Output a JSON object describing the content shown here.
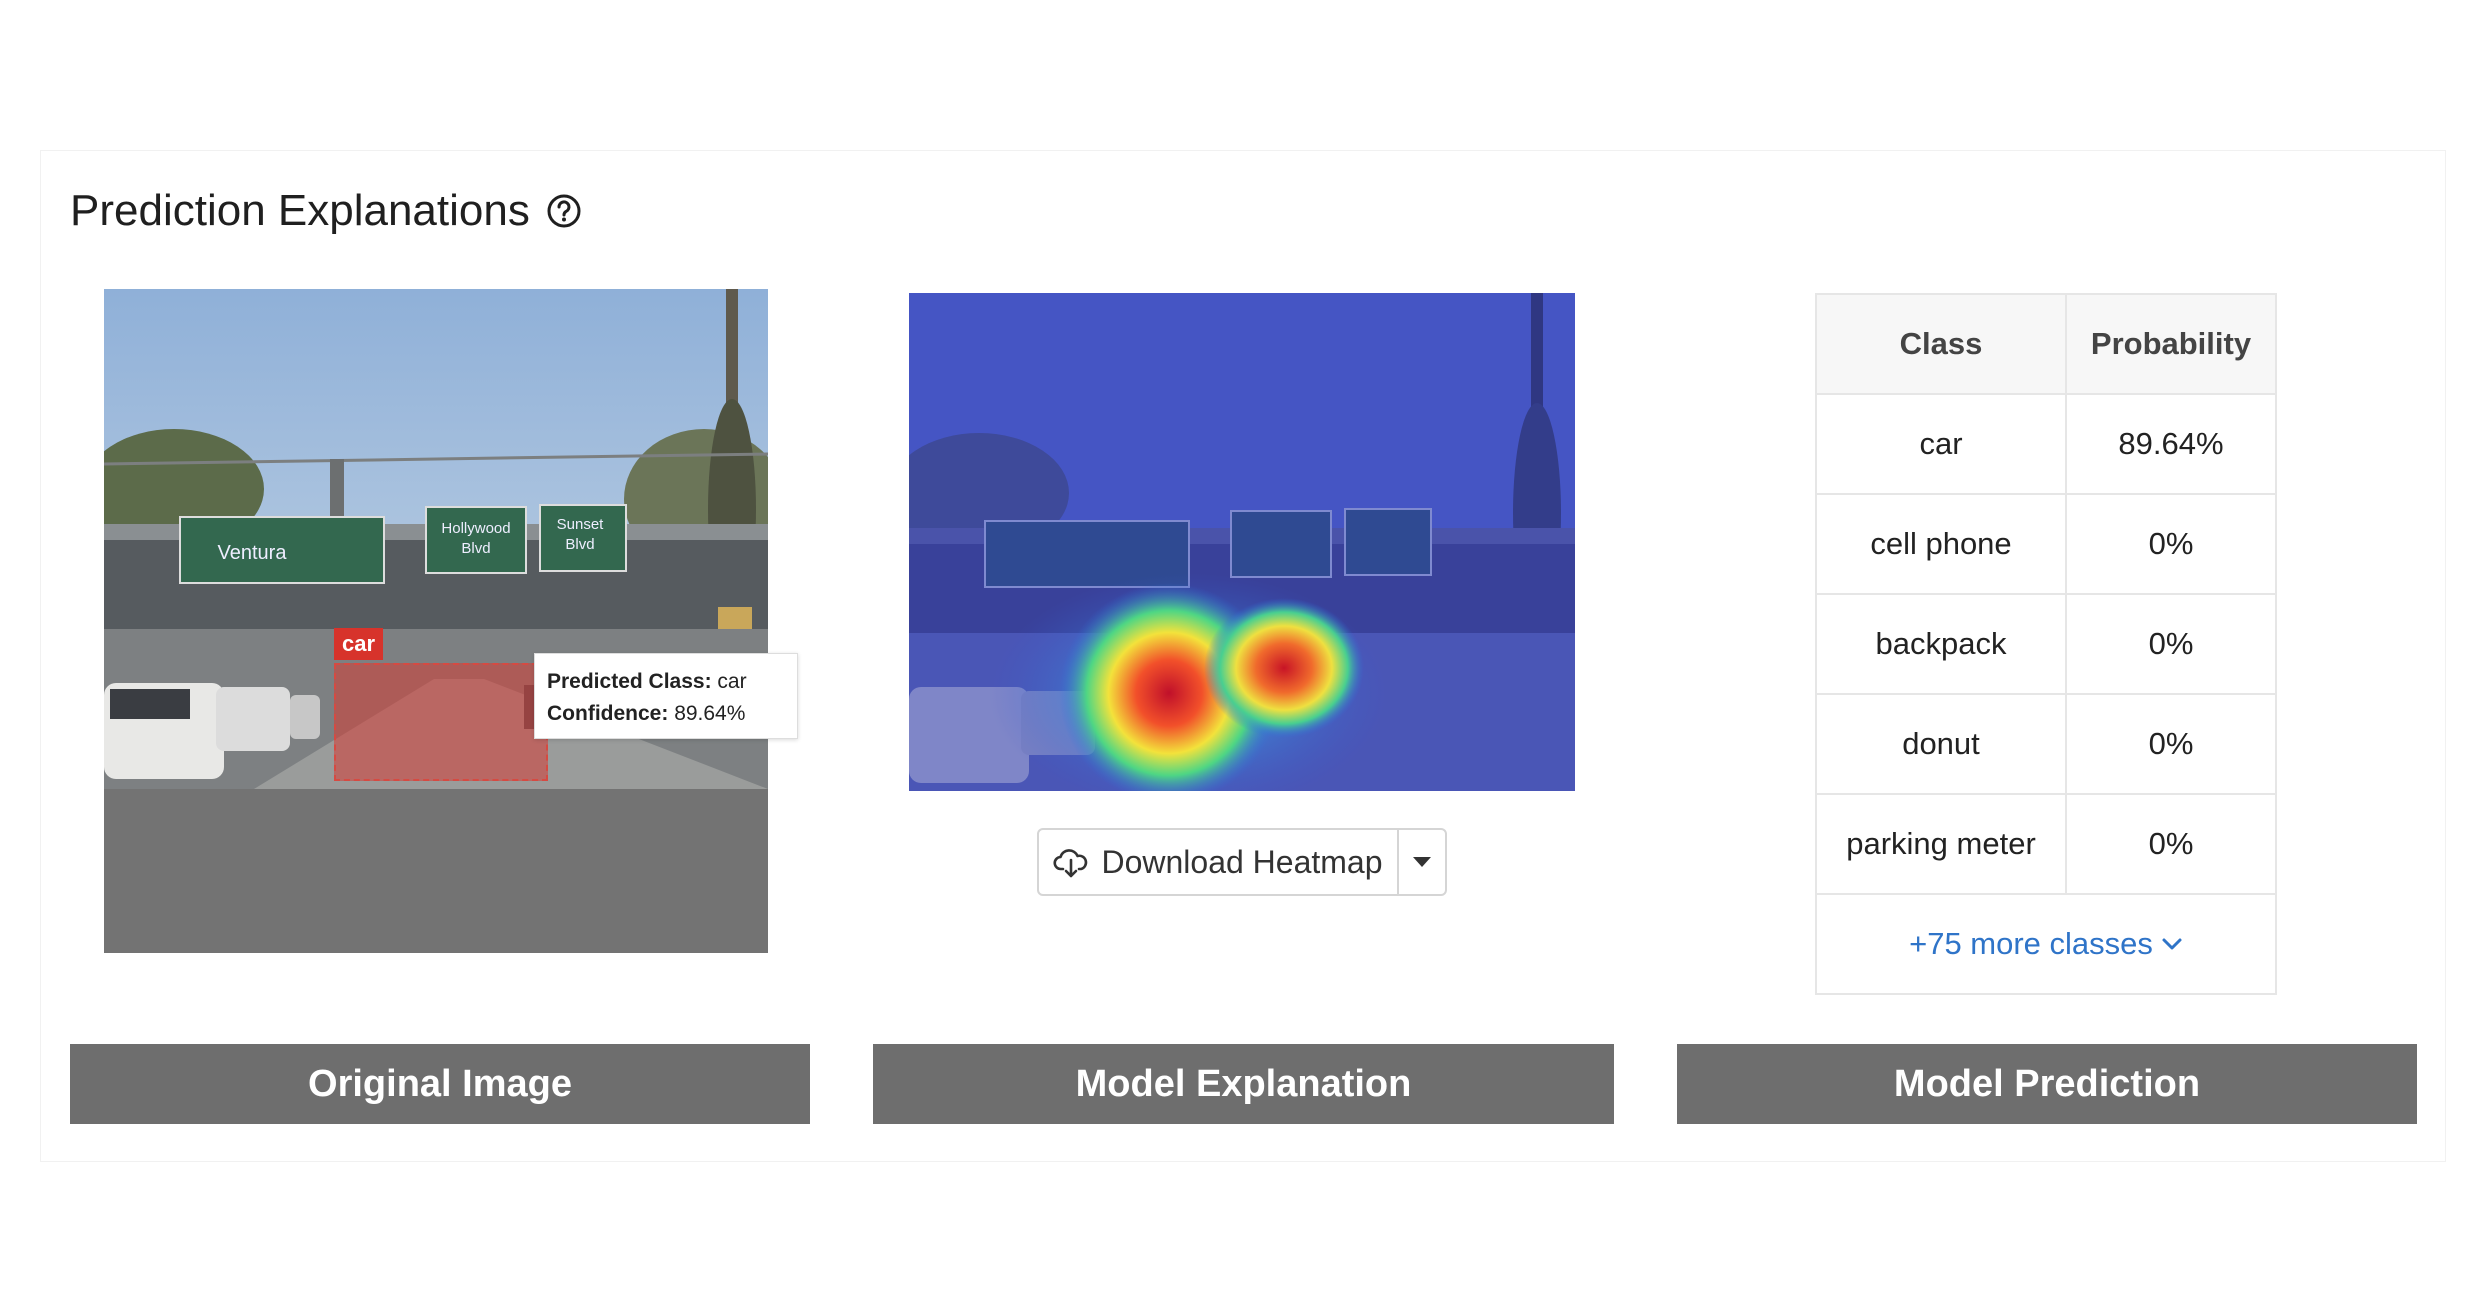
{
  "section": {
    "title": "Prediction Explanations",
    "help_icon": "question-circle-icon"
  },
  "original": {
    "bbox_label": "car",
    "tooltip_class_label": "Predicted Class:",
    "tooltip_class_value": "car",
    "tooltip_conf_label": "Confidence:",
    "tooltip_conf_value": "89.64%",
    "signs": [
      "Ventura",
      "Hollywood",
      "Blvd",
      "Sunset",
      "Blvd"
    ]
  },
  "explanation": {
    "download_label": "Download Heatmap",
    "download_icon": "cloud-download-icon",
    "caret_icon": "caret-down-icon"
  },
  "prediction_table": {
    "headers": [
      "Class",
      "Probability"
    ],
    "rows": [
      {
        "class": "car",
        "probability": "89.64%"
      },
      {
        "class": "cell phone",
        "probability": "0%"
      },
      {
        "class": "backpack",
        "probability": "0%"
      },
      {
        "class": "donut",
        "probability": "0%"
      },
      {
        "class": "parking meter",
        "probability": "0%"
      }
    ],
    "more_label": "+75 more classes"
  },
  "captions": {
    "original": "Original Image",
    "explanation": "Model Explanation",
    "prediction": "Model Prediction"
  },
  "colors": {
    "caption_bg": "#6e6e6e",
    "bbox": "#d7332b",
    "link": "#2f74c8",
    "heat_tint": "#3f52c8"
  }
}
